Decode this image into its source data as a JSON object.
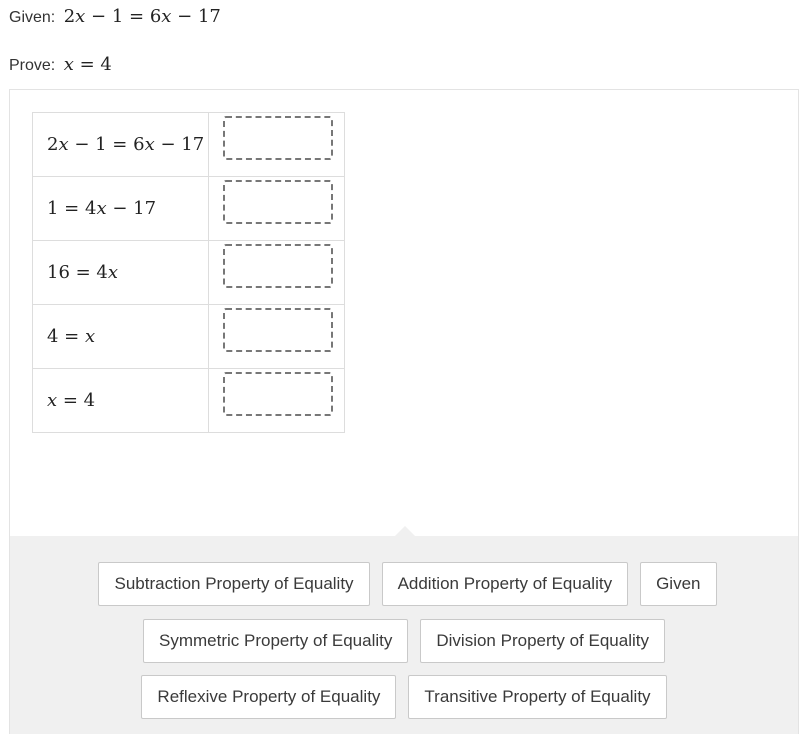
{
  "given": {
    "label": "Given:",
    "lhs_coef": "2",
    "lhs_var": "x",
    "lhs_rest": " − 1 = 6",
    "rhs_var": "x",
    "rhs_rest": " − 17"
  },
  "prove": {
    "label": "Prove:",
    "var": "x",
    "rest": " = 4"
  },
  "proof": {
    "rows": [
      {
        "statement": [
          {
            "t": "2"
          },
          {
            "t": "x",
            "v": true
          },
          {
            "t": " − 1 = 6"
          },
          {
            "t": "x",
            "v": true
          },
          {
            "t": " − 17"
          }
        ],
        "reason": ""
      },
      {
        "statement": [
          {
            "t": "1 = 4"
          },
          {
            "t": "x",
            "v": true
          },
          {
            "t": " − 17"
          }
        ],
        "reason": ""
      },
      {
        "statement": [
          {
            "t": "16 = 4"
          },
          {
            "t": "x",
            "v": true
          }
        ],
        "reason": ""
      },
      {
        "statement": [
          {
            "t": "4 = "
          },
          {
            "t": "x",
            "v": true
          }
        ],
        "reason": ""
      },
      {
        "statement": [
          {
            "t": "x",
            "v": true
          },
          {
            "t": " = 4"
          }
        ],
        "reason": ""
      }
    ]
  },
  "tray": {
    "rows": [
      [
        "Subtraction Property of Equality",
        "Addition Property of Equality",
        "Given"
      ],
      [
        "Symmetric Property of Equality",
        "Division Property of Equality"
      ],
      [
        "Reflexive Property of Equality",
        "Transitive Property of Equality"
      ]
    ]
  }
}
